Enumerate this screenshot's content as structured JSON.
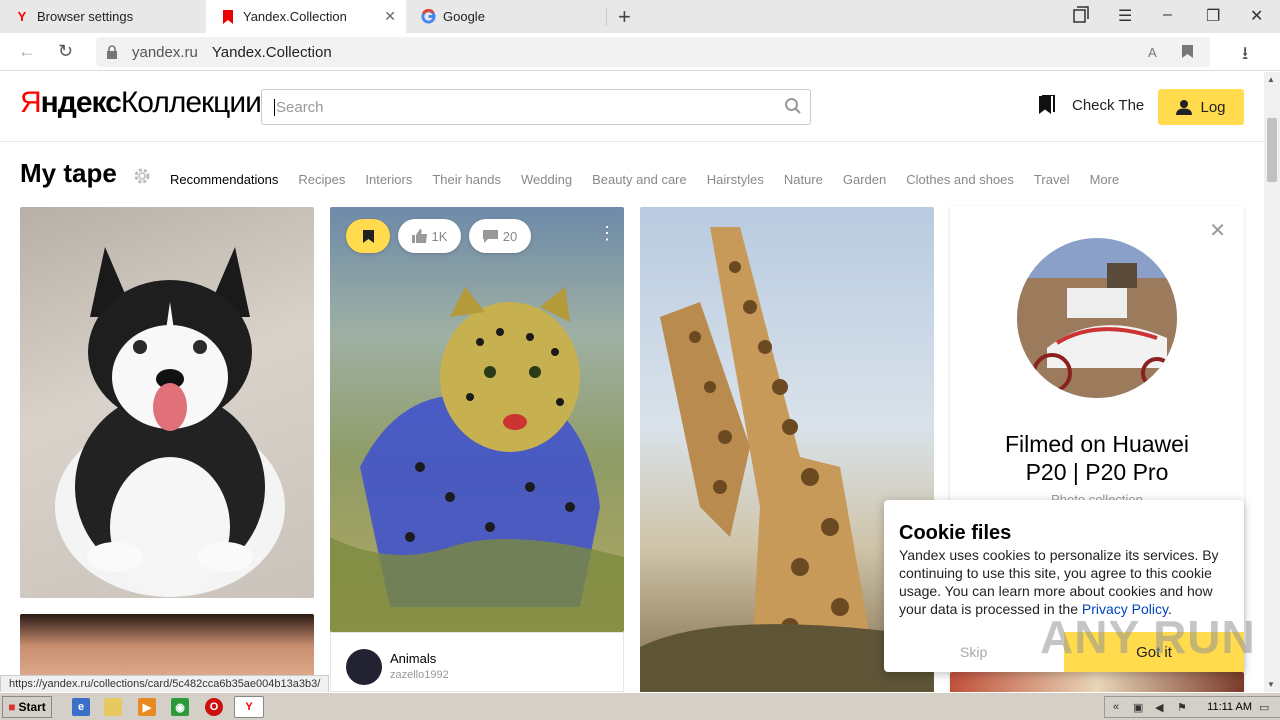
{
  "browser": {
    "tabs": [
      {
        "label": "Browser settings",
        "favicon": "yandex-y-icon"
      },
      {
        "label": "Yandex.Collection",
        "favicon": "collection-bookmark-icon",
        "active": true
      },
      {
        "label": "Google",
        "favicon": "google-g-icon"
      }
    ],
    "new_tab_symbol": "+",
    "address": {
      "host": "yandex.ru",
      "title": "Yandex.Collection"
    }
  },
  "header": {
    "logo_ya": "Я",
    "logo_ndex": "ндекс",
    "logo_collections": "Коллекции",
    "search_placeholder": "Search",
    "check_label": "Check The",
    "login_label": "Log"
  },
  "tape": {
    "title": "My tape",
    "categories": [
      "Recommendations",
      "Recipes",
      "Interiors",
      "Their hands",
      "Wedding",
      "Beauty and care",
      "Hairstyles",
      "Nature",
      "Garden",
      "Clothes and shoes",
      "Travel",
      "More"
    ]
  },
  "card2": {
    "likes": "1K",
    "comments": "20",
    "author_collection": "Animals",
    "author_user": "zazello1992"
  },
  "promo": {
    "title": "Filmed on Huawei P20 | P20 Pro",
    "subtitle": "Photo collection"
  },
  "cookie": {
    "title": "Cookie files",
    "body": "Yandex uses cookies to personalize its services. By continuing to use this site, you agree to this cookie usage. You can learn more about cookies and how your data is processed in the",
    "link": "Privacy Policy",
    "skip": "Skip",
    "gotit": "Got it"
  },
  "status_url": "https://yandex.ru/collections/card/5c482cca6b35ae004b13a3b3/",
  "watermark": "ANY RUN",
  "taskbar": {
    "start": "Start",
    "clock": "11:11 AM"
  },
  "colors": {
    "accent_yellow": "#ffdb4d",
    "yandex_red": "#ff0000",
    "link_blue": "#0044bb"
  }
}
